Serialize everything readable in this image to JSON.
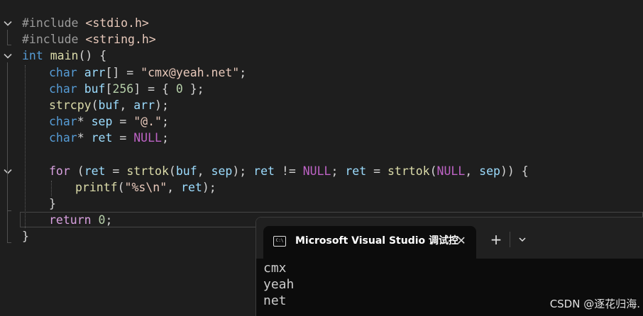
{
  "editor": {
    "lines": [
      {
        "id": "l1",
        "tokens": [
          {
            "c": "pp",
            "t": "#include "
          },
          {
            "c": "inc",
            "t": "<stdio.h>"
          }
        ]
      },
      {
        "id": "l2",
        "tokens": [
          {
            "c": "pp",
            "t": "#include "
          },
          {
            "c": "inc",
            "t": "<string.h>"
          }
        ]
      },
      {
        "id": "l3",
        "tokens": [
          {
            "c": "kw",
            "t": "int"
          },
          {
            "c": "def",
            "t": " "
          },
          {
            "c": "fn",
            "t": "main"
          },
          {
            "c": "def",
            "t": "() {"
          }
        ]
      },
      {
        "id": "l4",
        "tokens": [
          {
            "c": "kw",
            "t": "char"
          },
          {
            "c": "def",
            "t": " "
          },
          {
            "c": "var",
            "t": "arr"
          },
          {
            "c": "def",
            "t": "[] = "
          },
          {
            "c": "str",
            "t": "\"cmx@yeah.net\""
          },
          {
            "c": "def",
            "t": ";"
          }
        ]
      },
      {
        "id": "l5",
        "tokens": [
          {
            "c": "kw",
            "t": "char"
          },
          {
            "c": "def",
            "t": " "
          },
          {
            "c": "var",
            "t": "buf"
          },
          {
            "c": "def",
            "t": "["
          },
          {
            "c": "num",
            "t": "256"
          },
          {
            "c": "def",
            "t": "] = { "
          },
          {
            "c": "num",
            "t": "0"
          },
          {
            "c": "def",
            "t": " };"
          }
        ]
      },
      {
        "id": "l6",
        "tokens": [
          {
            "c": "fn",
            "t": "strcpy"
          },
          {
            "c": "def",
            "t": "("
          },
          {
            "c": "var",
            "t": "buf"
          },
          {
            "c": "def",
            "t": ", "
          },
          {
            "c": "var",
            "t": "arr"
          },
          {
            "c": "def",
            "t": ");"
          }
        ]
      },
      {
        "id": "l7",
        "tokens": [
          {
            "c": "kw",
            "t": "char"
          },
          {
            "c": "def",
            "t": "* "
          },
          {
            "c": "var",
            "t": "sep"
          },
          {
            "c": "def",
            "t": " = "
          },
          {
            "c": "str",
            "t": "\"@.\""
          },
          {
            "c": "def",
            "t": ";"
          }
        ]
      },
      {
        "id": "l8",
        "tokens": [
          {
            "c": "kw",
            "t": "char"
          },
          {
            "c": "def",
            "t": "* "
          },
          {
            "c": "var",
            "t": "ret"
          },
          {
            "c": "def",
            "t": " = "
          },
          {
            "c": "mac",
            "t": "NULL"
          },
          {
            "c": "def",
            "t": ";"
          }
        ]
      },
      {
        "id": "l9",
        "tokens": []
      },
      {
        "id": "l10",
        "tokens": [
          {
            "c": "ctl",
            "t": "for"
          },
          {
            "c": "def",
            "t": " ("
          },
          {
            "c": "var",
            "t": "ret"
          },
          {
            "c": "def",
            "t": " = "
          },
          {
            "c": "fn",
            "t": "strtok"
          },
          {
            "c": "def",
            "t": "("
          },
          {
            "c": "var",
            "t": "buf"
          },
          {
            "c": "def",
            "t": ", "
          },
          {
            "c": "var",
            "t": "sep"
          },
          {
            "c": "def",
            "t": "); "
          },
          {
            "c": "var",
            "t": "ret"
          },
          {
            "c": "def",
            "t": " != "
          },
          {
            "c": "mac",
            "t": "NULL"
          },
          {
            "c": "def",
            "t": "; "
          },
          {
            "c": "var",
            "t": "ret"
          },
          {
            "c": "def",
            "t": " = "
          },
          {
            "c": "fn",
            "t": "strtok"
          },
          {
            "c": "def",
            "t": "("
          },
          {
            "c": "mac",
            "t": "NULL"
          },
          {
            "c": "def",
            "t": ", "
          },
          {
            "c": "var",
            "t": "sep"
          },
          {
            "c": "def",
            "t": ")) {"
          }
        ]
      },
      {
        "id": "l11",
        "tokens": [
          {
            "c": "fn",
            "t": "printf"
          },
          {
            "c": "def",
            "t": "("
          },
          {
            "c": "str",
            "t": "\"%s\\n\""
          },
          {
            "c": "def",
            "t": ", "
          },
          {
            "c": "var",
            "t": "ret"
          },
          {
            "c": "def",
            "t": ");"
          }
        ]
      },
      {
        "id": "l12",
        "tokens": [
          {
            "c": "def",
            "t": "}"
          }
        ]
      },
      {
        "id": "l13",
        "tokens": [
          {
            "c": "ctl",
            "t": "return"
          },
          {
            "c": "def",
            "t": " "
          },
          {
            "c": "num",
            "t": "0"
          },
          {
            "c": "def",
            "t": ";"
          }
        ]
      },
      {
        "id": "l14",
        "tokens": [
          {
            "c": "def",
            "t": "}"
          }
        ]
      }
    ]
  },
  "terminal": {
    "tab_title": "Microsoft Visual Studio 调试控",
    "tab_icon_text": "C:\\",
    "close_glyph": "✕",
    "new_tab_glyph": "+",
    "output": [
      "cmx",
      "yeah",
      "net"
    ]
  },
  "watermark": "CSDN @逐花归海."
}
